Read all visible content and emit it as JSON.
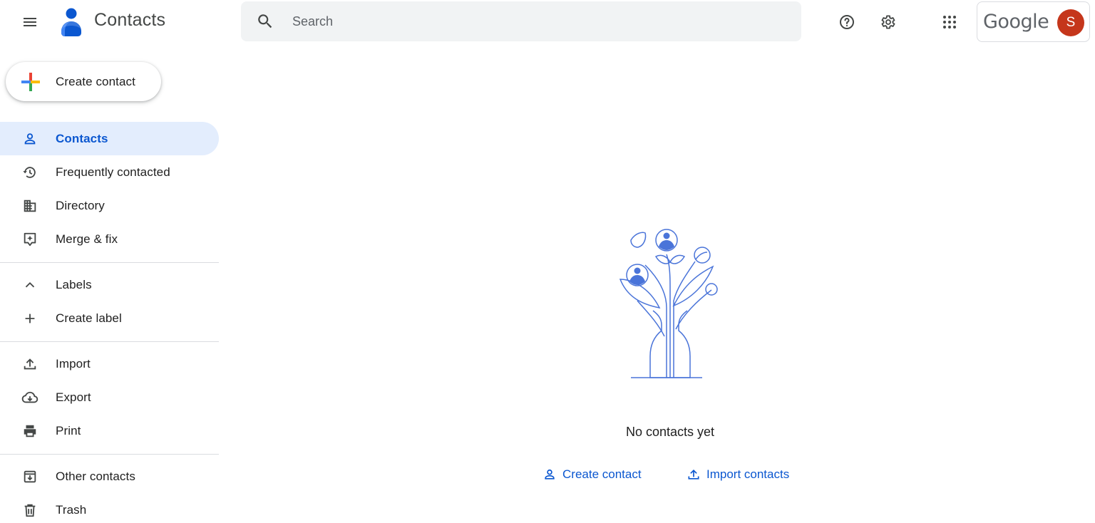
{
  "header": {
    "menu_icon": "hamburger-menu-icon",
    "app_title": "Contacts",
    "search_placeholder": "Search",
    "help_icon": "help-icon",
    "settings_icon": "gear-icon",
    "apps_icon": "apps-grid-icon",
    "account_brand": "Google",
    "avatar_initial": "S",
    "avatar_color": "#c5361b"
  },
  "sidebar": {
    "create_label": "Create contact",
    "items": [
      {
        "label": "Contacts",
        "icon": "person-icon",
        "active": true
      },
      {
        "label": "Frequently contacted",
        "icon": "history-icon"
      },
      {
        "label": "Directory",
        "icon": "building-icon"
      },
      {
        "label": "Merge & fix",
        "icon": "merge-fix-icon"
      }
    ],
    "labels_section": {
      "header": "Labels",
      "create_label": "Create label"
    },
    "tools": [
      {
        "label": "Import",
        "icon": "upload-icon"
      },
      {
        "label": "Export",
        "icon": "cloud-download-icon"
      },
      {
        "label": "Print",
        "icon": "printer-icon"
      }
    ],
    "bottom": [
      {
        "label": "Other contacts",
        "icon": "archive-icon"
      },
      {
        "label": "Trash",
        "icon": "trash-icon"
      }
    ]
  },
  "main": {
    "empty_message": "No contacts yet",
    "create_contact_link": "Create contact",
    "import_contacts_link": "Import contacts",
    "accent_color": "#0b57d0"
  }
}
